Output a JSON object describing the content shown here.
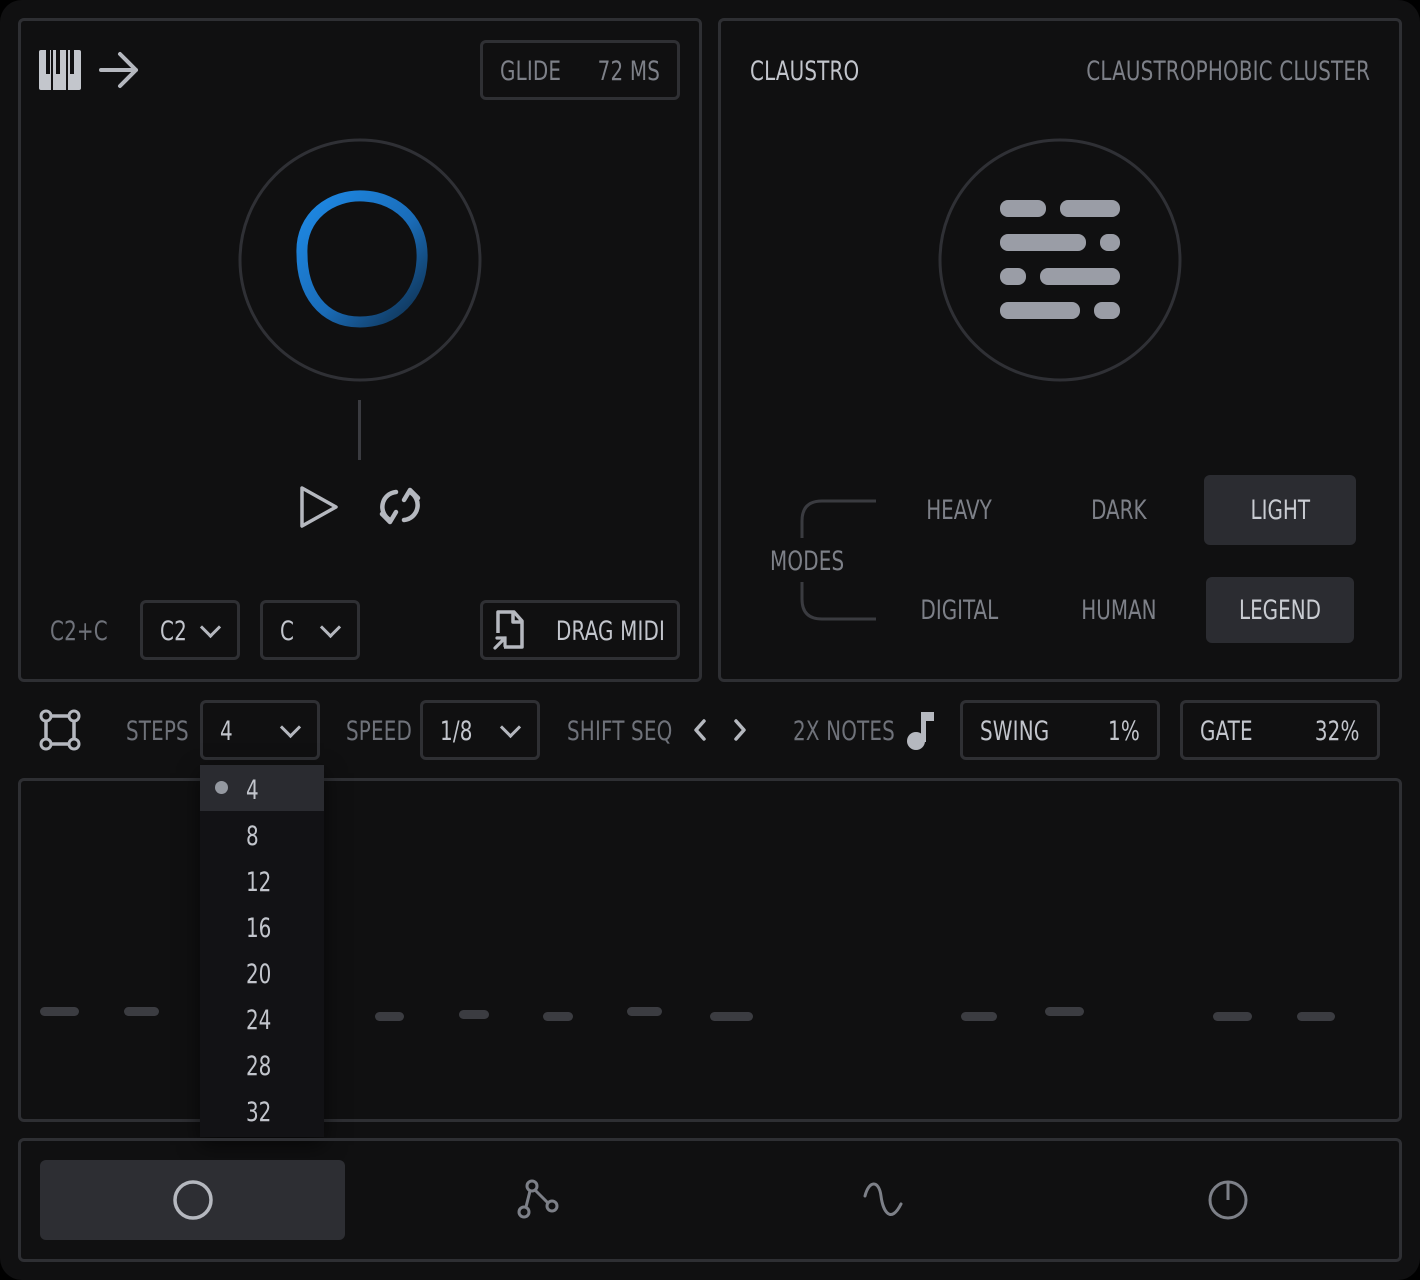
{
  "left_panel": {
    "glide": {
      "label": "GLIDE",
      "value": "72 MS"
    },
    "range_label": "C2+C",
    "octave_select": {
      "value": "C2"
    },
    "key_select": {
      "value": "C"
    },
    "drag_midi_label": "DRAG MIDI"
  },
  "right_panel": {
    "preset_name": "CLAUSTRO",
    "preset_description": "CLAUSTROPHOBIC CLUSTER",
    "modes_label": "MODES",
    "modes": [
      {
        "label": "HEAVY",
        "active": false
      },
      {
        "label": "DARK",
        "active": false
      },
      {
        "label": "LIGHT",
        "active": true
      },
      {
        "label": "DIGITAL",
        "active": false
      },
      {
        "label": "HUMAN",
        "active": false
      },
      {
        "label": "LEGEND",
        "active": true
      }
    ]
  },
  "toolbar": {
    "steps_label": "STEPS",
    "steps_value": "4",
    "speed_label": "SPEED",
    "speed_value": "1/8",
    "shift_label": "SHIFT SEQ",
    "notes_label": "2X NOTES",
    "swing": {
      "label": "SWING",
      "value": "1%"
    },
    "gate": {
      "label": "GATE",
      "value": "32%"
    }
  },
  "steps_dropdown": {
    "options": [
      "4",
      "8",
      "12",
      "16",
      "20",
      "24",
      "28",
      "32"
    ],
    "selected": "4"
  },
  "bottom_tabs": [
    "circle-icon",
    "nodes-icon",
    "wave-icon",
    "power-icon"
  ],
  "colors": {
    "accent": "#1e8be8",
    "background": "#101011",
    "border": "#2e2f33",
    "active": "#2b2c31"
  }
}
